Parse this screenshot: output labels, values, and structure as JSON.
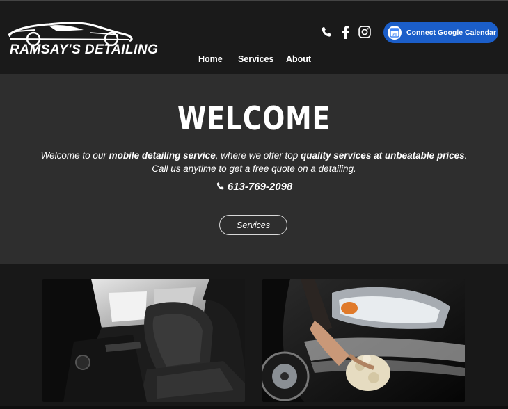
{
  "brand": {
    "name": "RAMSAY'S DETAILING"
  },
  "header": {
    "social_icons": [
      "phone-icon",
      "facebook-icon",
      "instagram-icon"
    ],
    "calendar_button": {
      "label": "Connect Google Calendar",
      "icon": "google-calendar-icon",
      "icon_text": "31",
      "color": "#1b5ec9"
    }
  },
  "nav": {
    "items": [
      "Home",
      "Services",
      "About"
    ]
  },
  "hero": {
    "title": "WELCOME",
    "line1": {
      "t1": "Welcome to our ",
      "b1": "mobile detailing service",
      "t2": ", where we offer top ",
      "b2": "quality services at unbeatable prices",
      "t3": "."
    },
    "line2": "Call us anytime to get a free quote on a detailing.",
    "phone": "613-769-2098",
    "button_label": "Services"
  },
  "gallery": [
    {
      "name": "car-interior-photo",
      "subject": "car interior seats"
    },
    {
      "name": "car-washing-photo",
      "subject": "hand washing car with foam mitt"
    }
  ]
}
